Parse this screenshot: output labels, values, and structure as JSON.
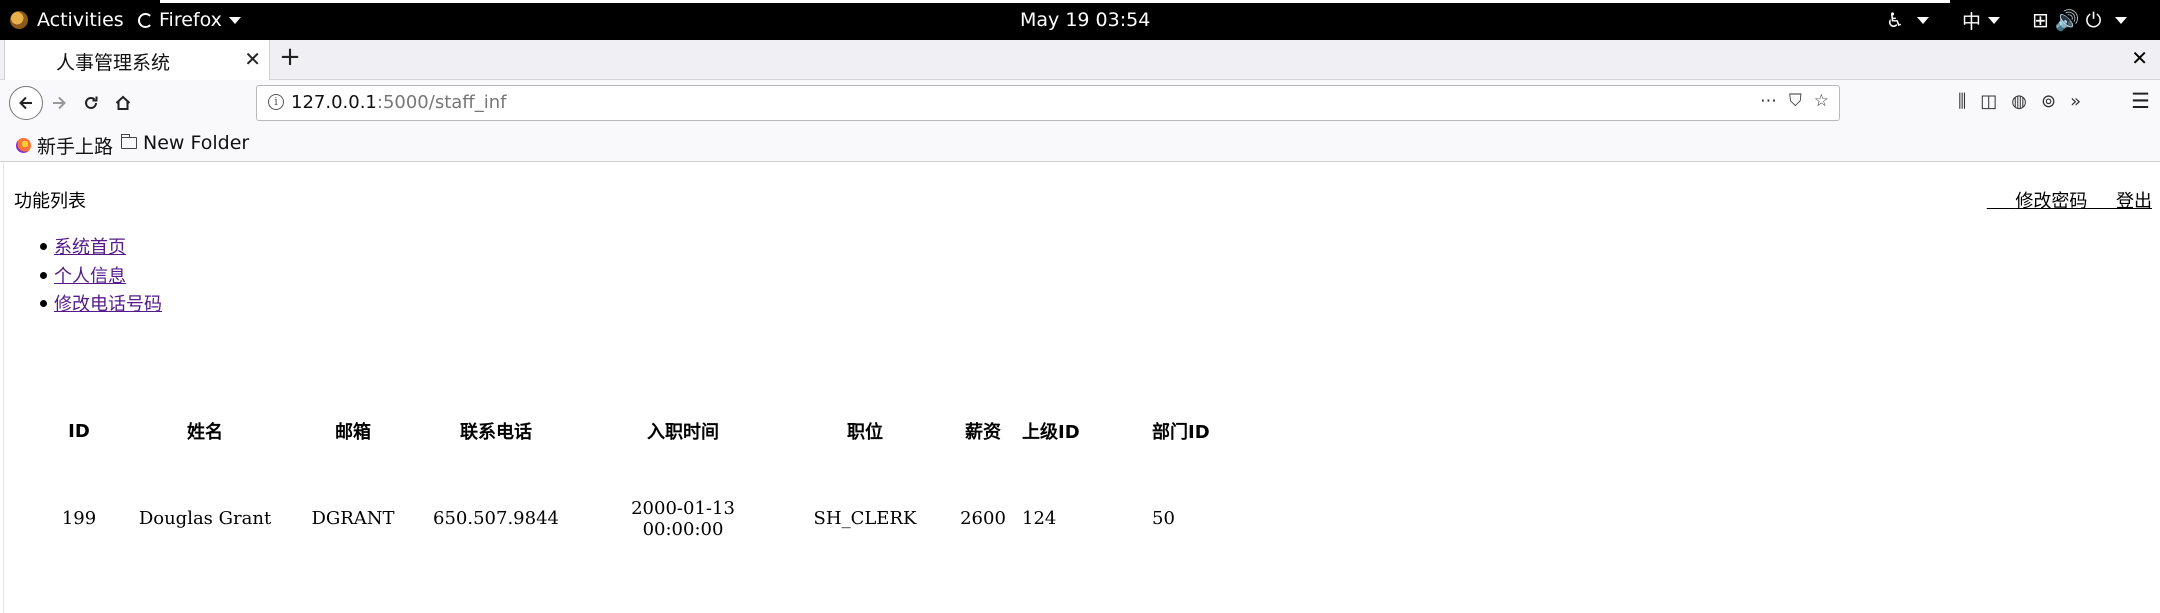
{
  "system": {
    "activities": "Activities",
    "app_menu": "Firefox",
    "clock": "May 19  03:54",
    "ime": "中"
  },
  "browser": {
    "tab_title": "人事管理系统",
    "url_host": "127.0.0.1",
    "url_rest": ":5000/staff_inf",
    "bookmarks": [
      "新手上路",
      "New Folder"
    ]
  },
  "page": {
    "func_title": "功能列表",
    "top_links": [
      "修改密码",
      "登出"
    ],
    "nav_items": [
      "系统首页",
      "个人信息",
      "修改电话号码"
    ],
    "table": {
      "headers": [
        "ID",
        "姓名",
        "邮箱",
        "联系电话",
        "入职时间",
        "职位",
        "薪资",
        "上级ID",
        "部门ID"
      ],
      "rows": [
        [
          "199",
          "Douglas Grant",
          "DGRANT",
          "650.507.9844",
          "2000-01-13 00:00:00",
          "SH_CLERK",
          "2600",
          "124",
          "50"
        ]
      ]
    }
  }
}
